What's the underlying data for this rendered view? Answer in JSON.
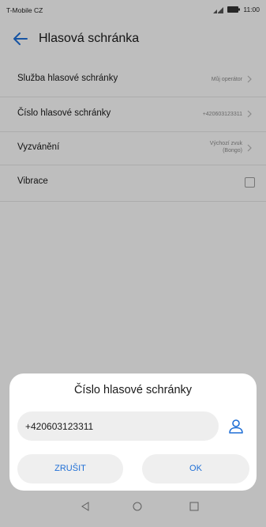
{
  "status_bar": {
    "carrier": "T-Mobile CZ",
    "time": "11:00"
  },
  "app_bar": {
    "title": "Hlasová schránka"
  },
  "settings": [
    {
      "label": "Služba hlasové schránky",
      "value": "Můj operátor",
      "chevron": true
    },
    {
      "label": "Číslo hlasové schránky",
      "value": "+420603123311",
      "chevron": true
    },
    {
      "label": "Vyzvánění",
      "value_line1": "Výchozí zvuk",
      "value_line2": "(Bongo)",
      "chevron": true
    },
    {
      "label": "Vibrace",
      "checked": false
    }
  ],
  "dialog": {
    "title": "Číslo hlasové schránky",
    "input_value": "+420603123311",
    "cancel_label": "ZRUŠIT",
    "ok_label": "OK"
  },
  "colors": {
    "accent": "#1f6fd6",
    "background": "#fafafa",
    "dialog": "#ffffff",
    "field": "#eeeeee"
  },
  "icons": [
    "back-arrow-icon",
    "signal-icon",
    "battery-icon",
    "chevron-right-icon",
    "contact-icon",
    "nav-back-icon",
    "nav-home-icon",
    "nav-recents-icon"
  ]
}
